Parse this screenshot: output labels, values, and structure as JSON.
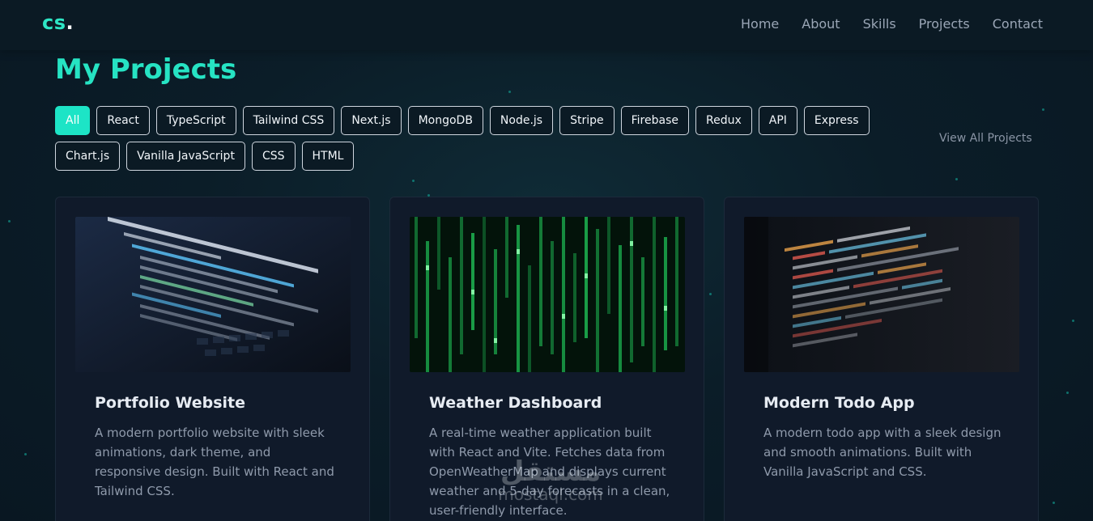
{
  "nav": {
    "logo": "cs",
    "logo_dot": ".",
    "links": [
      "Home",
      "About",
      "Skills",
      "Projects",
      "Contact"
    ]
  },
  "page": {
    "title": "My Projects",
    "view_all": "View All Projects"
  },
  "filters": [
    "All",
    "React",
    "TypeScript",
    "Tailwind CSS",
    "Next.js",
    "MongoDB",
    "Node.js",
    "Stripe",
    "Firebase",
    "Redux",
    "API",
    "Express",
    "Chart.js",
    "Vanilla JavaScript",
    "CSS",
    "HTML"
  ],
  "active_filter": "All",
  "projects": [
    {
      "title": "Portfolio Website",
      "description": "A modern portfolio website with sleek animations, dark theme, and responsive design. Built with React and Tailwind CSS."
    },
    {
      "title": "Weather Dashboard",
      "description": "A real-time weather application built with React and Vite. Fetches data from OpenWeatherMap and displays current weather and 5-day forecasts in a clean, user-friendly interface."
    },
    {
      "title": "Modern Todo App",
      "description": "A modern todo app with a sleek design and smooth animations. Built with Vanilla JavaScript and CSS."
    }
  ],
  "watermark": {
    "arabic": "مستقل",
    "latin": "mostaql.com"
  },
  "colors": {
    "accent": "#26e3c3",
    "background": "#0b1d28",
    "card": "#101a2a"
  }
}
